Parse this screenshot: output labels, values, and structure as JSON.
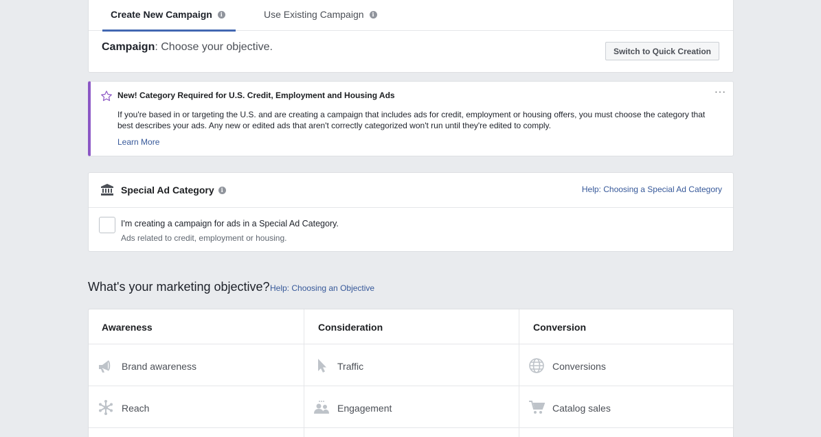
{
  "tabs": [
    {
      "label": "Create New Campaign"
    },
    {
      "label": "Use Existing Campaign"
    }
  ],
  "campaign": {
    "prefix": "Campaign",
    "text": ": Choose your objective.",
    "quick_button": "Switch to Quick Creation"
  },
  "notice": {
    "title": "New! Category Required for U.S. Credit, Employment and Housing Ads",
    "body": "If you're based in or targeting the U.S. and are creating a campaign that includes ads for credit, employment or housing offers, you must choose the category that best describes your ads. Any new or edited ads that aren't correctly categorized won't run until they're edited to comply.",
    "link": "Learn More",
    "more": "···"
  },
  "special_ad": {
    "title": "Special Ad Category",
    "help": "Help: Choosing a Special Ad Category",
    "checkbox_label": "I'm creating a campaign for ads in a Special Ad Category.",
    "checkbox_sub": "Ads related to credit, employment or housing."
  },
  "objective": {
    "heading": "What's your marketing objective?",
    "help": "Help: Choosing an Objective",
    "columns": [
      {
        "header": "Awareness",
        "items": [
          {
            "label": "Brand awareness",
            "icon": "megaphone-icon"
          },
          {
            "label": "Reach",
            "icon": "asterisk-icon"
          }
        ]
      },
      {
        "header": "Consideration",
        "items": [
          {
            "label": "Traffic",
            "icon": "cursor-icon"
          },
          {
            "label": "Engagement",
            "icon": "people-icon"
          }
        ]
      },
      {
        "header": "Conversion",
        "items": [
          {
            "label": "Conversions",
            "icon": "globe-icon"
          },
          {
            "label": "Catalog sales",
            "icon": "cart-icon"
          }
        ]
      }
    ]
  },
  "colors": {
    "accent": "#4267b2",
    "link": "#365899",
    "notice_border": "#8c57c5",
    "icon_muted": "#bec3c9"
  }
}
